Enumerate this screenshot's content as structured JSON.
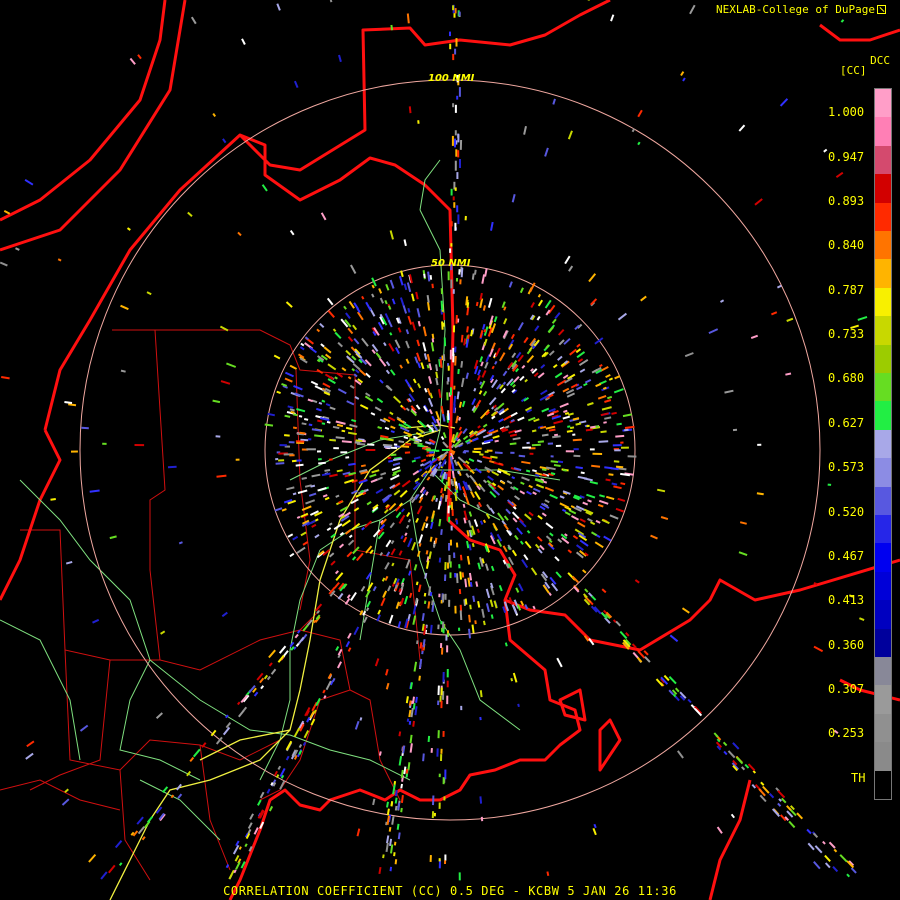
{
  "header": {
    "credit": "NEXLAB-College of DuPage",
    "credit_icon": "external-link-icon",
    "product_code": "DCC",
    "unit": "[CC]"
  },
  "footer": {
    "caption": "CORRELATION COEFFICIENT (CC) 0.5 DEG - KCBW 5 JAN 26 11:36"
  },
  "range_rings": [
    {
      "label": "100 NMI"
    },
    {
      "label": "50 NMI"
    }
  ],
  "legend": {
    "labels": [
      "1.000",
      "0.947",
      "0.893",
      "0.840",
      "0.787",
      "0.733",
      "0.680",
      "0.627",
      "0.573",
      "0.520",
      "0.467",
      "0.413",
      "0.360",
      "0.307",
      "0.253",
      "TH"
    ],
    "colors": [
      "#ff9ec8",
      "#ff7fb5",
      "#d44a6e",
      "#d20000",
      "#ff2a00",
      "#ff7400",
      "#ffb400",
      "#f8f000",
      "#c8d800",
      "#9ccc00",
      "#66dd22",
      "#22ee44",
      "#a8a8e8",
      "#8c8ce4",
      "#5858e0",
      "#2626e8",
      "#0000f0",
      "#0000d8",
      "#0000c0",
      "#00009c",
      "#888898",
      "#9a9a9a",
      "#909090",
      "#8a8a8a",
      "#000000"
    ]
  },
  "colors": {
    "state_border": "#ff1010",
    "county_line": "#d01010",
    "highway": "#7fe07f",
    "interstate": "#f0f040",
    "range_ring": "#f0a8a0",
    "label": "#ffff00"
  }
}
